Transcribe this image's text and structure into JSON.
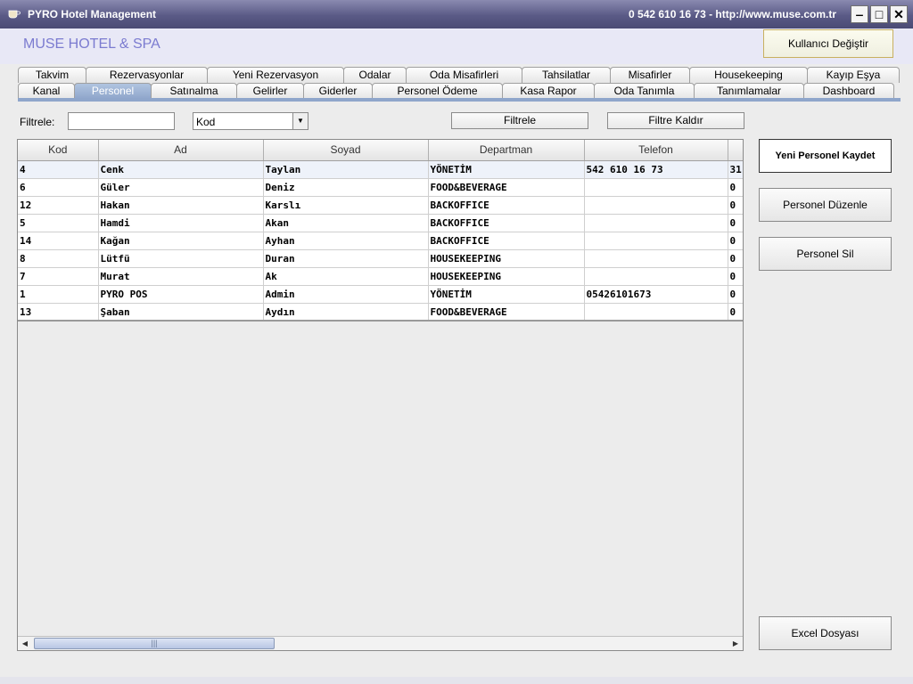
{
  "window": {
    "title": "PYRO Hotel Management",
    "contact": "0 542 610 16 73  -  http://www.muse.com.tr",
    "min_label": "‒",
    "max_label": "□",
    "close_label": "✕"
  },
  "header": {
    "brand": "MUSE HOTEL & SPA",
    "user_button": "Kullanıcı Değiştir"
  },
  "tabs_row1": [
    "Takvim",
    "Rezervasyonlar",
    "Yeni Rezervasyon",
    "Odalar",
    "Oda Misafirleri",
    "Tahsilatlar",
    "Misafirler",
    "Housekeeping",
    "Kayıp Eşya"
  ],
  "tabs_row2": [
    "Kanal",
    "Personel",
    "Satınalma",
    "Gelirler",
    "Giderler",
    "Personel Ödeme",
    "Kasa Rapor",
    "Oda Tanımla",
    "Tanımlamalar",
    "Dashboard"
  ],
  "active_tab": "Personel",
  "filter": {
    "label": "Filtrele:",
    "input_value": "",
    "field_selected": "Kod",
    "filter_button": "Filtrele",
    "clear_button": "Filtre Kaldır"
  },
  "table": {
    "columns": [
      "Kod",
      "Ad",
      "Soyad",
      "Departman",
      "Telefon",
      ""
    ],
    "rows": [
      [
        "4",
        "Cenk",
        "Taylan",
        "YÖNETİM",
        "542 610 16 73",
        "31"
      ],
      [
        "6",
        "Güler",
        "Deniz",
        "FOOD&BEVERAGE",
        "",
        "0"
      ],
      [
        "12",
        "Hakan",
        "Karslı",
        "BACKOFFICE",
        "",
        "0"
      ],
      [
        "5",
        "Hamdi",
        "Akan",
        "BACKOFFICE",
        "",
        "0"
      ],
      [
        "14",
        "Kağan",
        "Ayhan",
        "BACKOFFICE",
        "",
        "0"
      ],
      [
        "8",
        "Lütfü",
        "Duran",
        "HOUSEKEEPING",
        "",
        "0"
      ],
      [
        "7",
        "Murat",
        "Ak",
        "HOUSEKEEPING",
        "",
        "0"
      ],
      [
        "1",
        "PYRO POS",
        "Admin",
        "YÖNETİM",
        "05426101673",
        "0"
      ],
      [
        "13",
        "Şaban",
        "Aydın",
        "FOOD&BEVERAGE",
        "",
        "0"
      ]
    ]
  },
  "actions": {
    "new_personnel": "Yeni Personel Kaydet",
    "edit_personnel": "Personel Düzenle",
    "delete_personnel": "Personel Sil",
    "excel": "Excel Dosyası"
  },
  "icons": {
    "app": "coffee-cup-icon",
    "dropdown": "chevron-down-icon",
    "scroll_left": "arrow-left-icon",
    "scroll_right": "arrow-right-icon"
  },
  "colors": {
    "brand": "#7b7bd0",
    "active_tab": "#8fa6cb",
    "title_bar": "#5a5a86"
  }
}
